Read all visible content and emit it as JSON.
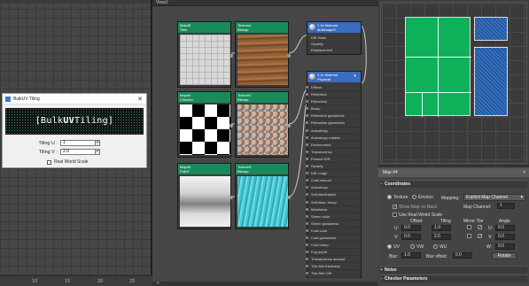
{
  "left_viewport": {
    "ruler_ticks": [
      "10",
      "15",
      "20",
      "25"
    ]
  },
  "bulkuv_dialog": {
    "title": "BulkUV Tiling",
    "close_label": "✕",
    "banner_prefix": "[Bulk",
    "banner_bold": "UV",
    "banner_suffix": "Tiling]",
    "tiling_u_label": "Tiling U :",
    "tiling_u_value": "1",
    "tiling_v_label": "Tiling V :",
    "tiling_v_value": "2.0",
    "real_world_label": "Real World Scale"
  },
  "slate": {
    "view_label": "View1",
    "bottom_label": "≡"
  },
  "nodes": [
    {
      "title": "Map#8",
      "subtitle": "Tiles"
    },
    {
      "title": "Textured",
      "subtitle": "Bitmap"
    },
    {
      "title": "Map#4",
      "subtitle": "Checker"
    },
    {
      "title": "Texture2",
      "subtitle": "Bitmap"
    },
    {
      "title": "Map#6",
      "subtitle": "FalloT"
    },
    {
      "title": "Texture5",
      "subtitle": "Bitmap"
    }
  ],
  "mat_top": {
    "title": "1 3c Material",
    "subtitle": "Multimap#3",
    "rows": [
      "Diff. Base",
      "Opacity",
      "Displacement"
    ]
  },
  "mat_main": {
    "title": "3 3c Material",
    "subtitle": "Physical",
    "rows": [
      "Diffuse",
      "Reflection",
      "Refraction",
      "Bump",
      "Reflection glossiness",
      "Refraction glossiness",
      "Anisotropy",
      "Anisotropy rotation",
      "Environment",
      "Translucency",
      "Fresnel IOR",
      "Opacity",
      "Diff. rough",
      "Coat amount",
      "Anisotropy",
      "Self-illumination",
      "Self-illum. bump",
      "Metalness",
      "Sheen color",
      "Sheen glossiness",
      "Coat color",
      "Coat glossiness",
      "Coat bump",
      "Fog depth",
      "Translucence amount",
      "Thin film thickness",
      "Thin film IOR"
    ]
  },
  "right_viewport": {},
  "panel": {
    "header": "Map #4",
    "close": "×",
    "coordinates_label": "Coordinates",
    "texture_label": "Texture",
    "environ_label": "Environ",
    "mapping_label": "Mapping:",
    "mapping_value": "Explicit Map Channel",
    "show_map_label": "Show Map on Back",
    "map_channel_label": "Map Channel:",
    "map_channel_value": "1",
    "realworld_label": "Use Real-World Scale",
    "offset_label": "Offset",
    "tiling_label": "Tiling",
    "mirror_tile_label": "Mirror Tile",
    "angle_label": "Angle",
    "u_label": "U:",
    "v_label": "V:",
    "w_label": "W:",
    "u_offset": "0.0",
    "v_offset": "0.0",
    "u_tiling": "1.0",
    "v_tiling": "2.0",
    "u_angle": "0.0",
    "v_angle": "0.0",
    "w_angle": "0.0",
    "uv_label": "UV",
    "vw_label": "VW",
    "wu_label": "WU",
    "blur_label": "Blur:",
    "blur_value": "1.0",
    "blur_offset_label": "Blur offset:",
    "blur_offset_value": "0.0",
    "rotate_label": "Rotate",
    "noise_label": "Noise",
    "checker_label": "Checker Parameters"
  }
}
